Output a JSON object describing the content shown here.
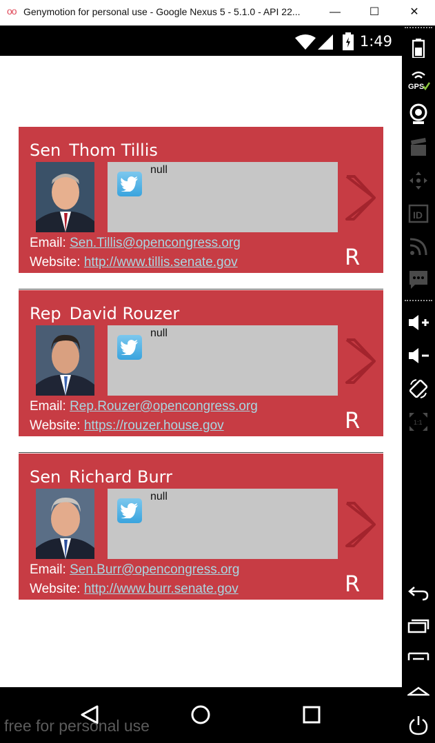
{
  "window": {
    "title": "Genymotion for personal use - Google Nexus 5 - 5.1.0 - API 22...",
    "logo_text": "oo",
    "minimize_glyph": "—",
    "maximize_glyph": "☐",
    "close_glyph": "✕"
  },
  "statusbar": {
    "time": "1:49"
  },
  "cards": [
    {
      "title_prefix": "Sen",
      "name": "Thom Tillis",
      "tweet": "null",
      "email_label": "Email:",
      "email": "Sen.Tillis@opencongress.org",
      "website_label": "Website:",
      "website": "http://www.tillis.senate.gov",
      "party": "R"
    },
    {
      "title_prefix": "Rep",
      "name": "David Rouzer",
      "tweet": "null",
      "email_label": "Email:",
      "email": "Rep.Rouzer@opencongress.org",
      "website_label": "Website:",
      "website": "https://rouzer.house.gov",
      "party": "R"
    },
    {
      "title_prefix": "Sen",
      "name": "Richard Burr",
      "tweet": "null",
      "email_label": "Email:",
      "email": "Sen.Burr@opencongress.org",
      "website_label": "Website:",
      "website": "http://www.burr.senate.gov",
      "party": "R"
    }
  ],
  "sidebar": {
    "items": [
      "battery-icon",
      "gps-icon",
      "webcam-icon",
      "capture-icon",
      "dpad-icon",
      "id-icon",
      "rss-icon",
      "sms-icon",
      "volume-up-icon",
      "volume-down-icon",
      "rotate-icon",
      "scale-icon",
      "back-icon",
      "recent-apps-icon",
      "menu-icon",
      "home-icon",
      "power-icon"
    ],
    "gps_label": "GPS",
    "id_label": "ID",
    "scale_label": "1:1"
  },
  "watermark": "free for personal use",
  "colors": {
    "card": "#c73c44",
    "link": "#a9d7e2",
    "tweet_box": "#c6c6c6"
  }
}
